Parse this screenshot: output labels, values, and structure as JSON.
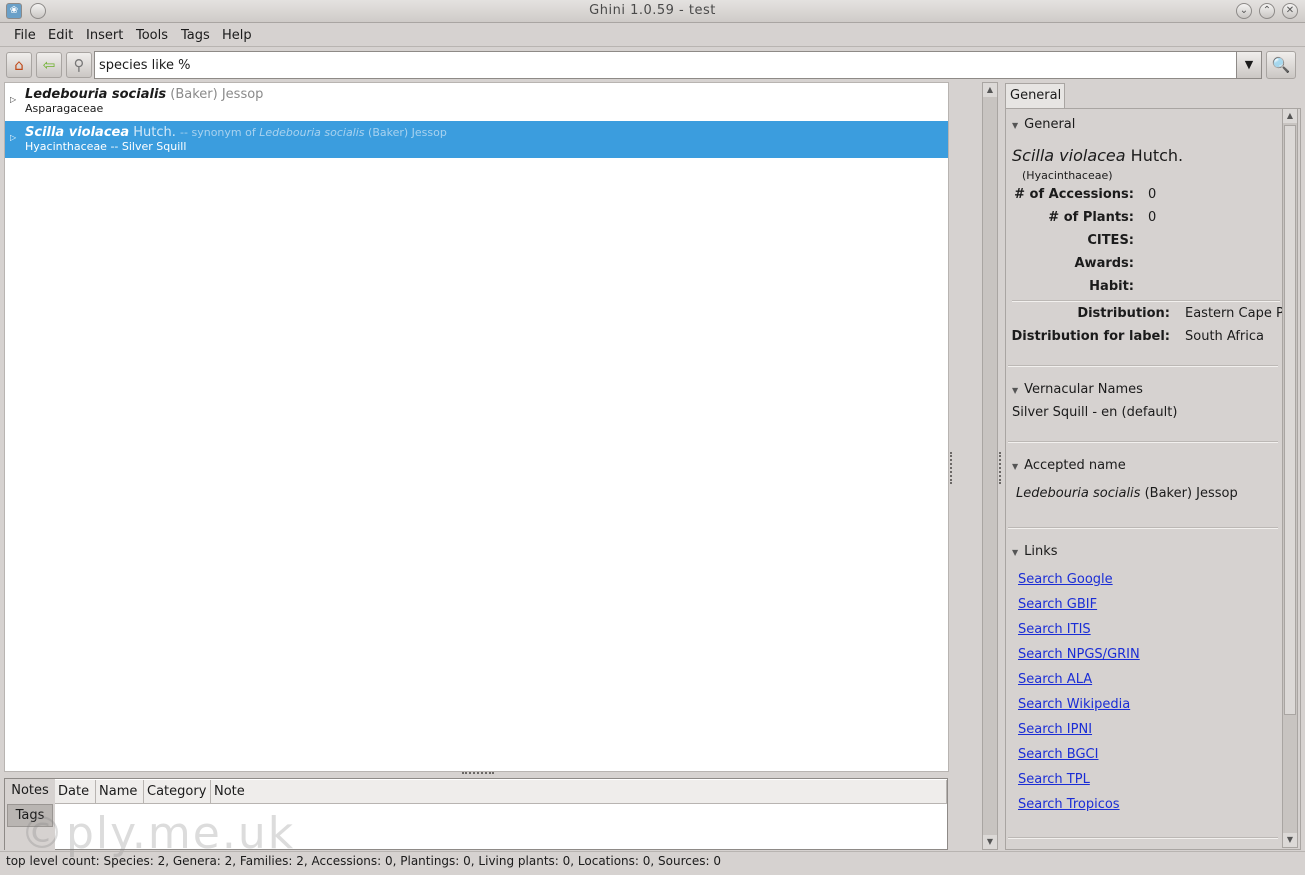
{
  "window": {
    "title": "Ghini 1.0.59 - test"
  },
  "menu": [
    "File",
    "Edit",
    "Insert",
    "Tools",
    "Tags",
    "Help"
  ],
  "search": {
    "value": "species like %"
  },
  "results": [
    {
      "name": "Ledebouria socialis",
      "author": "(Baker) Jessop",
      "synonym_label": "",
      "synonym_name": "",
      "synonym_author": "",
      "sub": "Asparagaceae",
      "selected": false
    },
    {
      "name": "Scilla violacea",
      "author": "Hutch.",
      "synonym_label": "-- synonym of",
      "synonym_name": "Ledebouria socialis",
      "synonym_author": "(Baker) Jessop",
      "sub": "Hyacinthaceae -- Silver Squill",
      "selected": true
    }
  ],
  "notes": {
    "tabs": [
      "Notes",
      "Tags"
    ],
    "columns": [
      "Date",
      "Name",
      "Category",
      "Note"
    ]
  },
  "status": "top level count: Species: 2, Genera: 2, Families: 2, Accessions: 0, Plantings: 0, Living plants: 0, Locations: 0, Sources: 0",
  "watermark": "©ply.me.uk",
  "details": {
    "tab": "General",
    "general": {
      "header": "General",
      "species_name": "Scilla violacea",
      "species_author": "Hutch.",
      "family": "(Hyacinthaceae)",
      "rows": [
        {
          "label": "# of Accessions:",
          "value": "0"
        },
        {
          "label": "# of Plants:",
          "value": "0"
        },
        {
          "label": "CITES:",
          "value": ""
        },
        {
          "label": "Awards:",
          "value": ""
        },
        {
          "label": "Habit:",
          "value": ""
        }
      ],
      "distribution_label": "Distribution:",
      "distribution_value": "Eastern Cape P",
      "distribution_label2": "Distribution for label:",
      "distribution_value2": "South Africa"
    },
    "vernacular": {
      "header": "Vernacular Names",
      "value": "Silver Squill - en (default)"
    },
    "accepted": {
      "header": "Accepted name",
      "name": "Ledebouria socialis",
      "author": "(Baker) Jessop"
    },
    "links": {
      "header": "Links",
      "items": [
        "Search Google",
        "Search GBIF",
        "Search ITIS",
        "Search NPGS/GRIN",
        "Search ALA",
        "Search Wikipedia",
        "Search IPNI",
        "Search BGCI",
        "Search TPL",
        "Search Tropicos"
      ]
    }
  }
}
